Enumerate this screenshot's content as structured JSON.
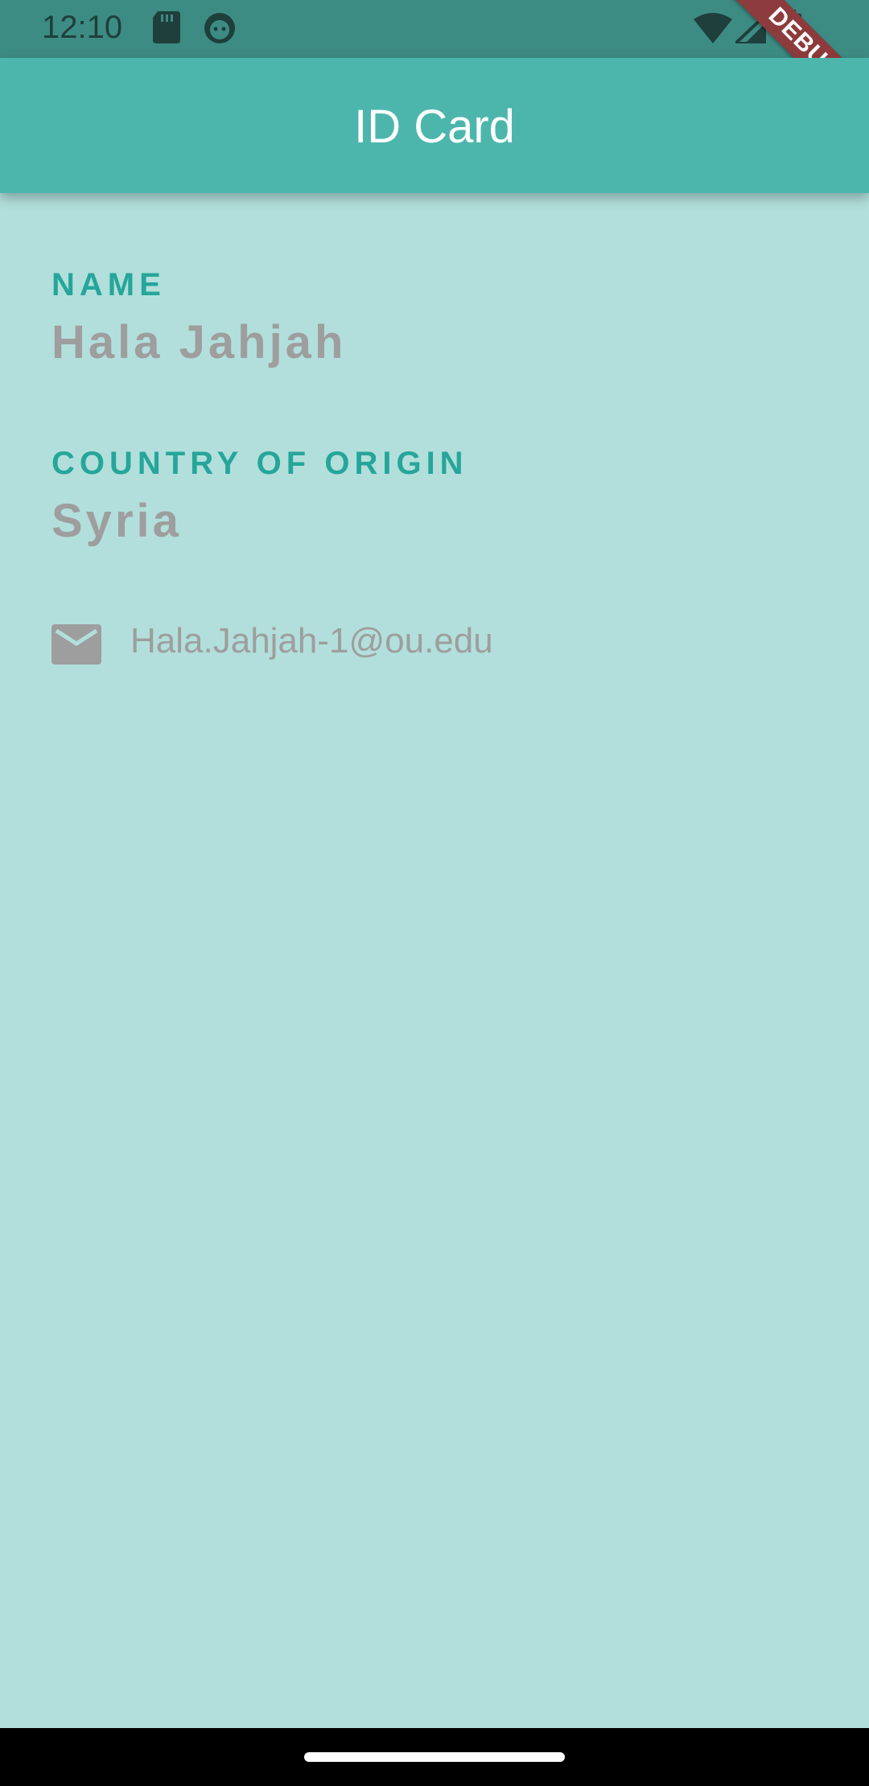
{
  "status_bar": {
    "time": "12:10",
    "icons": [
      "sd-card-icon",
      "android-debug-icon",
      "wifi-icon",
      "cell-signal-icon",
      "battery-icon"
    ]
  },
  "app_bar": {
    "title": "ID Card"
  },
  "debug_banner": "DEBUG",
  "profile": {
    "name_label": "NAME",
    "name_value": "Hala Jahjah",
    "country_label": "COUNTRY OF ORIGIN",
    "country_value": "Syria",
    "email": "Hala.Jahjah-1@ou.edu"
  },
  "colors": {
    "app_bar": "#4db6ac",
    "status_bar": "#3d8c84",
    "background": "#b2dfdb",
    "label": "#26a69a",
    "value": "#9e9e9e",
    "debug_banner": "#8e3b3d"
  }
}
